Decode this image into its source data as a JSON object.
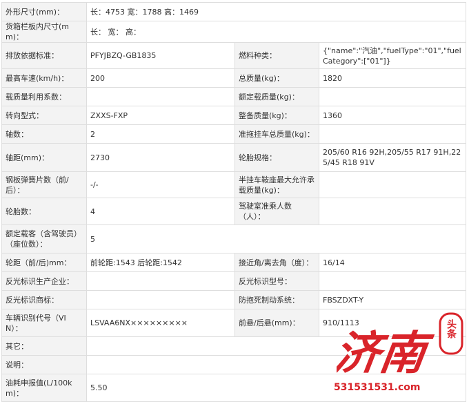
{
  "rows": {
    "r0": {
      "label": "外形尺寸(mm)：",
      "value": "长：4753 宽：1788 高：1469"
    },
    "r1": {
      "label": "货箱栏板内尺寸(mm)：",
      "value": "长： 宽： 高："
    },
    "r2": {
      "l1": "排放依据标准：",
      "v1": "PFYJBZQ-GB1835",
      "l2": "燃料种类：",
      "v2": "{\"name\":\"汽油\",\"fuelType\":\"01\",\"fuelCategory\":[\"01\"]}"
    },
    "r3": {
      "l1": "最高车速(km/h)：",
      "v1": "200",
      "l2": "总质量(kg)：",
      "v2": "1820"
    },
    "r4": {
      "l1": "载质量利用系数：",
      "v1": "",
      "l2": "额定载质量(kg)：",
      "v2": ""
    },
    "r5": {
      "l1": "转向型式：",
      "v1": "ZXXS-FXP",
      "l2": "整备质量(kg)：",
      "v2": "1360"
    },
    "r6": {
      "l1": "轴数：",
      "v1": "2",
      "l2": "准拖挂车总质量(kg)：",
      "v2": ""
    },
    "r7": {
      "l1": "轴距(mm)：",
      "v1": "2730",
      "l2": "轮胎规格：",
      "v2": "205/60 R16 92H,205/55 R17 91H,225/45 R18 91V"
    },
    "r8": {
      "l1": "钢板弹簧片数（前/后）：",
      "v1": "-/-",
      "l2": "半挂车鞍座最大允许承载质量(kg)：",
      "v2": ""
    },
    "r9": {
      "l1": "轮胎数：",
      "v1": "4",
      "l2": "驾驶室准乘人数（人）：",
      "v2": ""
    },
    "r10": {
      "label": "额定载客（含驾驶员）（座位数）：",
      "value": "5"
    },
    "r11": {
      "l1": "轮距（前/后)mm：",
      "v1": "前轮距:1543 后轮距:1542",
      "l2": "接近角/离去角（度）：",
      "v2": "16/14"
    },
    "r12": {
      "l1": "反光标识生产企业：",
      "v1": "",
      "l2": "反光标识型号：",
      "v2": ""
    },
    "r13": {
      "l1": "反光标识商标：",
      "v1": "",
      "l2": "防抱死制动系统：",
      "v2": "FBSZDXT-Y"
    },
    "r14": {
      "l1": "车辆识别代号（VIN）：",
      "v1": "LSVAA6NX×××××××××",
      "l2": "前悬/后悬(mm)：",
      "v2": "910/1113"
    },
    "r15": {
      "label": "其它：",
      "value": ""
    },
    "r16": {
      "label": "说明：",
      "value": ""
    },
    "r17": {
      "label": "油耗申报值(L/100km)：",
      "value": "5.50"
    }
  },
  "watermark": {
    "brand_text": "济南",
    "tag_text": "头条",
    "url_text": "531531531.com",
    "color": "#d9242a"
  }
}
